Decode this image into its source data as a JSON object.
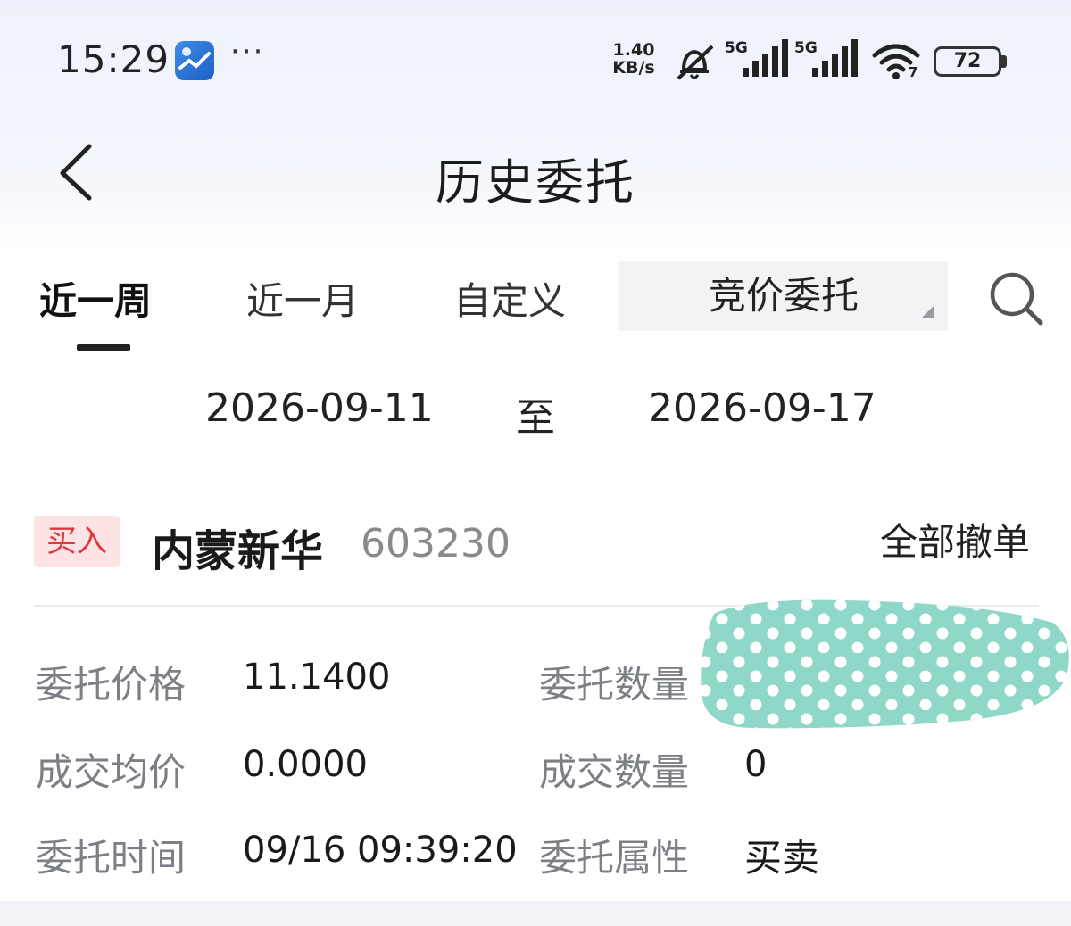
{
  "status_bar": {
    "time": "15:29",
    "app_icon": "sina-finance-icon",
    "more": "···",
    "net_speed_value": "1.40",
    "net_speed_unit": "KB/s",
    "signal_1": "5G",
    "signal_2": "5G",
    "wifi_level": "7",
    "battery": "72"
  },
  "header": {
    "title": "历史委托"
  },
  "tabs": [
    {
      "label": "近一周",
      "active": true
    },
    {
      "label": "近一月",
      "active": false
    },
    {
      "label": "自定义",
      "active": false
    }
  ],
  "filter": {
    "selected": "竞价委托"
  },
  "date_range": {
    "from": "2026-09-11",
    "separator": "至",
    "to": "2026-09-17"
  },
  "order": {
    "side": "买入",
    "name": "内蒙新华",
    "code": "603230",
    "action": "全部撤单",
    "fields": {
      "price_label": "委托价格",
      "price_value": "11.1400",
      "quantity_label": "委托数量",
      "avg_price_label": "成交均价",
      "avg_price_value": "0.0000",
      "filled_qty_label": "成交数量",
      "filled_qty_value": "0",
      "time_label": "委托时间",
      "time_value": "09/16 09:39:20",
      "attr_label": "委托属性",
      "attr_value": "买卖"
    }
  },
  "colors": {
    "buy_red": "#e0383e",
    "buy_bg": "#fde3e3",
    "redaction": "#8fd8c8"
  }
}
